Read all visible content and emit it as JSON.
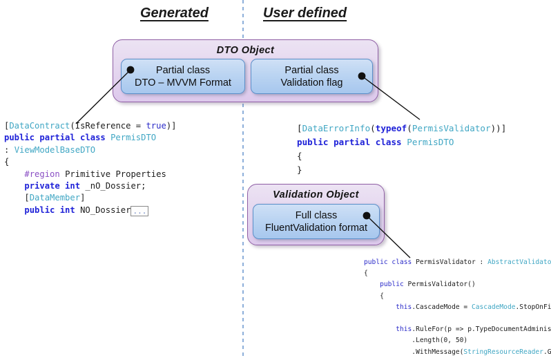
{
  "headers": {
    "generated": "Generated",
    "user_defined": "User defined"
  },
  "colors": {
    "group_border": "#8f5fa5",
    "group_fill": "#e4d6ef",
    "item_border": "#5b8fc9",
    "item_fill": "#bcd5f2",
    "divider": "#6f9bd1",
    "connector": "#111111",
    "keyword": "#1f22d8",
    "type": "#41a7c4",
    "preprocessor": "#8a4fc4",
    "string": "#c5292b"
  },
  "groups": [
    {
      "title": "DTO Object",
      "items": [
        {
          "line1": "Partial class",
          "line2": "DTO – MVVM Format"
        },
        {
          "line1": "Partial class",
          "line2": "Validation flag"
        }
      ]
    },
    {
      "title": "Validation Object",
      "items": [
        {
          "line1": "Full class",
          "line2": "FluentValidation format"
        }
      ]
    }
  ],
  "code_blocks": {
    "dto_mvvm": {
      "lines": [
        "[DataContract(IsReference = true)]",
        "public partial class PermisDTO",
        ": ViewModelBaseDTO",
        "{",
        "    #region Primitive Properties",
        "    private int _nO_Dossier;",
        "    [DataMember]",
        "    public int NO_Dossier..."
      ]
    },
    "validation_flag": {
      "lines": [
        "[DataErrorInfo(typeof(PermisValidator))]",
        "public partial class PermisDTO",
        "{",
        "}"
      ]
    },
    "fluent_validation": {
      "lines": [
        "public class PermisValidator : AbstractValidator<PermisDTO>",
        "{",
        "    public PermisValidator()",
        "    {",
        "        this.CascadeMode = CascadeMode.StopOnFirstFailure;",
        "",
        "        this.RuleFor(p => p.TypeDocumentAdministration)",
        "            .Length(0, 50)",
        "            .WithMessage(StringResourceReader.GetString(\"Field_Lenght\"));"
      ]
    }
  },
  "connectors": [
    {
      "from": "partial-class-dto-mvvm",
      "to": "dto-mvvm-code"
    },
    {
      "from": "partial-class-validation-flag",
      "to": "validation-flag-code"
    },
    {
      "from": "full-class-fluentvalidation",
      "to": "fluent-validation-code"
    }
  ]
}
